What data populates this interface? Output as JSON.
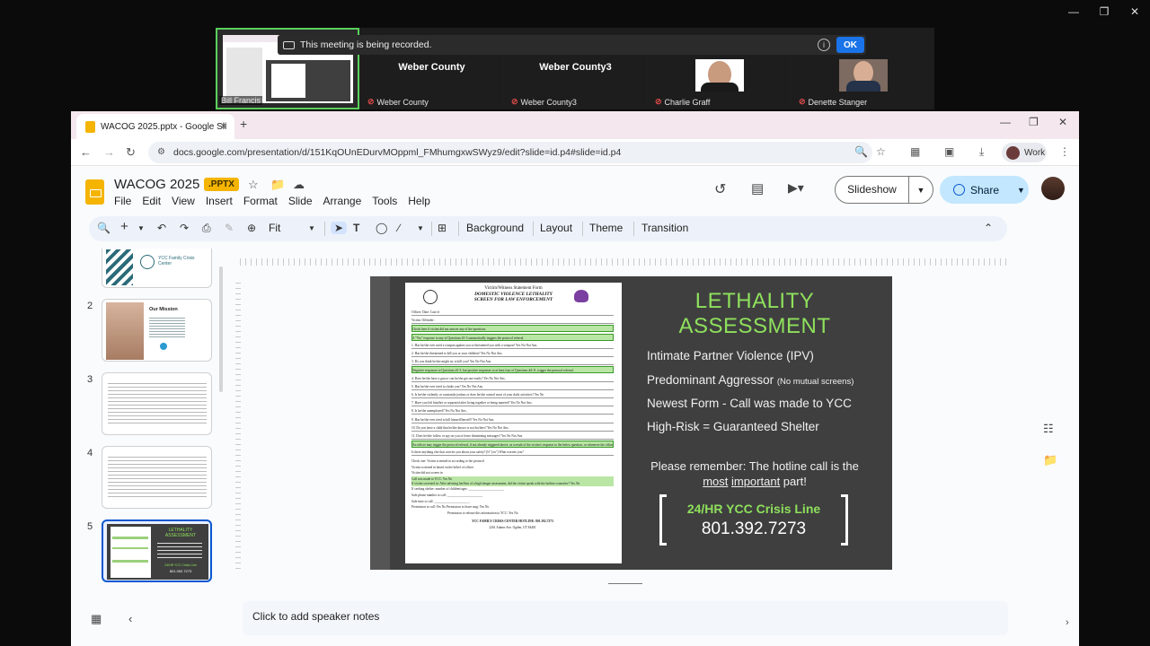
{
  "meeting": {
    "recording_banner": "This meeting is being recorded.",
    "ok_label": "OK",
    "participants": [
      {
        "display": "",
        "label": "Bill Francis"
      },
      {
        "display": "Weber County",
        "label": "Weber County"
      },
      {
        "display": "Weber County3",
        "label": "Weber County3"
      },
      {
        "display": "",
        "label": "Charlie Graff"
      },
      {
        "display": "",
        "label": "Denette Stanger"
      }
    ]
  },
  "browser": {
    "tab_title": "WACOG 2025.pptx - Google Sli",
    "url": "docs.google.com/presentation/d/151KqOUnEDurvMOppml_FMhumgxwSWyz9/edit?slide=id.p4#slide=id.p4",
    "profile_label": "Work"
  },
  "app": {
    "doc_title": "WACOG 2025",
    "badge": ".PPTX",
    "menus": [
      "File",
      "Edit",
      "View",
      "Insert",
      "Format",
      "Slide",
      "Arrange",
      "Tools",
      "Help"
    ],
    "slideshow_label": "Slideshow",
    "share_label": "Share",
    "toolbar": {
      "zoom": "Fit",
      "buttons": [
        "Background",
        "Layout",
        "Theme",
        "Transition"
      ]
    }
  },
  "filmstrip": {
    "numbers": [
      "2",
      "3",
      "4",
      "5"
    ],
    "thumb1_org": "YCC Family Crisis Center",
    "thumb2_title": "Our Mission",
    "thumb5_title": "LETHALITY ASSESSMENT",
    "thumb5_crisis": "24/HR YCC Crisis Line",
    "thumb5_phone": "801.392.7273"
  },
  "slide": {
    "title_line1": "LETHALITY",
    "title_line2": "ASSESSMENT",
    "bullets": [
      {
        "main": "Intimate Partner Violence (IPV)",
        "note": ""
      },
      {
        "main": "Predominant Aggressor ",
        "note": "(No mutual screens)"
      },
      {
        "main": "Newest Form - Call was made to YCC",
        "note": ""
      },
      {
        "main": "High-Risk  =  Guaranteed Shelter",
        "note": ""
      }
    ],
    "remember_pre": "Please remember: The hotline call is the ",
    "remember_most": "most",
    "remember_important": "important",
    "remember_post": " part!",
    "crisis_label": "24/HR YCC Crisis Line",
    "crisis_phone": "801.392.7273",
    "form": {
      "head1": "Victim/Witness Statement Form",
      "head2": "DOMESTIC VIOLENCE LETHALITY",
      "head3": "SCREEN FOR LAW ENFORCEMENT",
      "rows": [
        {
          "text": "Officer:                                              Date:                          Case #:",
          "green": false
        },
        {
          "text": "Victim:                                              Offender:",
          "green": false
        },
        {
          "text": "Check here if victim did not answer any of the questions.",
          "green": true
        },
        {
          "text": "A \"Yes\" response to any of Questions #1-3 automatically triggers the protocol referral.",
          "green": true
        },
        {
          "text": "1. Has he/she ever used a weapon against you or threatened you with a weapon?           Yes   No   Not Ans.",
          "green": false
        },
        {
          "text": "2. Has he/she threatened to kill you or your children?                                       Yes   No   Not Ans.",
          "green": false
        },
        {
          "text": "3. Do you think he/she might try to kill you?                                              Yes   No   Not Ans.",
          "green": false
        },
        {
          "text": "Negative responses to Questions #1-3, but positive responses to at least four of Questions #4-11, trigger the protocol referral.",
          "green": true
        },
        {
          "text": "4. Does he/she have a gun or can he/she get one easily?                                    Yes   No   Not Ans.",
          "green": false
        },
        {
          "text": "5. Has he/she ever tried to choke you?                                                      Yes   No   Not Ans.",
          "green": false
        },
        {
          "text": "6. Is he/she violently or constantly jealous or does he/she control most of your daily activities?   Yes   No",
          "green": false
        },
        {
          "text": "7. Have you left him/her or separated after living together or being married?             Yes   No   Not Ans.",
          "green": false
        },
        {
          "text": "8. Is he/she unemployed?                                                                   Yes   No   Not Ans.",
          "green": false
        },
        {
          "text": "9. Has he/she ever tried to kill himself/herself?                                            Yes   No   Not Ans.",
          "green": false
        },
        {
          "text": "10. Do you have a child that he/she knows is not his/hers?                                 Yes   No   Not Ans.",
          "green": false
        },
        {
          "text": "11. Does he/she follow or spy on you or leave threatening messages?                       Yes   No   Not Ans.",
          "green": false
        },
        {
          "text": "An officer may trigger the protocol referral, if not already triggered above, as a result of the victim's response to the below question, or whenever the officer believes the victim is in a potentially lethal situation.",
          "green": true
        },
        {
          "text": "Is there anything else that worries you about your safety? (If \"yes\")  What worries you?",
          "green": false
        }
      ],
      "check1": "Check one:    Victim screened in according to the protocol",
      "check2": "                     Victim screened in based on the belief of officer",
      "check3": "                     Victim did not screen in",
      "call": "Call was made to YCC:        Yes       No",
      "screened": "If victim screened in:    After advising her/him of a high danger assessment, did the victim speak with the hotline counselor?     Yes    No",
      "shelter": "If seeking shelter: number of children/ages:  ______________________",
      "phone": "Safe phone number to call:  ______________________",
      "time": "Safe time to call:  ______________________",
      "permission": "Permission to call:    Yes    No          Permission to leave msg:    Yes    No",
      "release": "Permission to release this information to YCC:    Yes    No",
      "footer1": "YCC FAMILY CRISIS CENTER HOTLINE: 801.392.7273",
      "footer2": "2261 Adams Ave. Ogden, UT 84401"
    }
  },
  "notes_placeholder": "Click to add speaker notes"
}
